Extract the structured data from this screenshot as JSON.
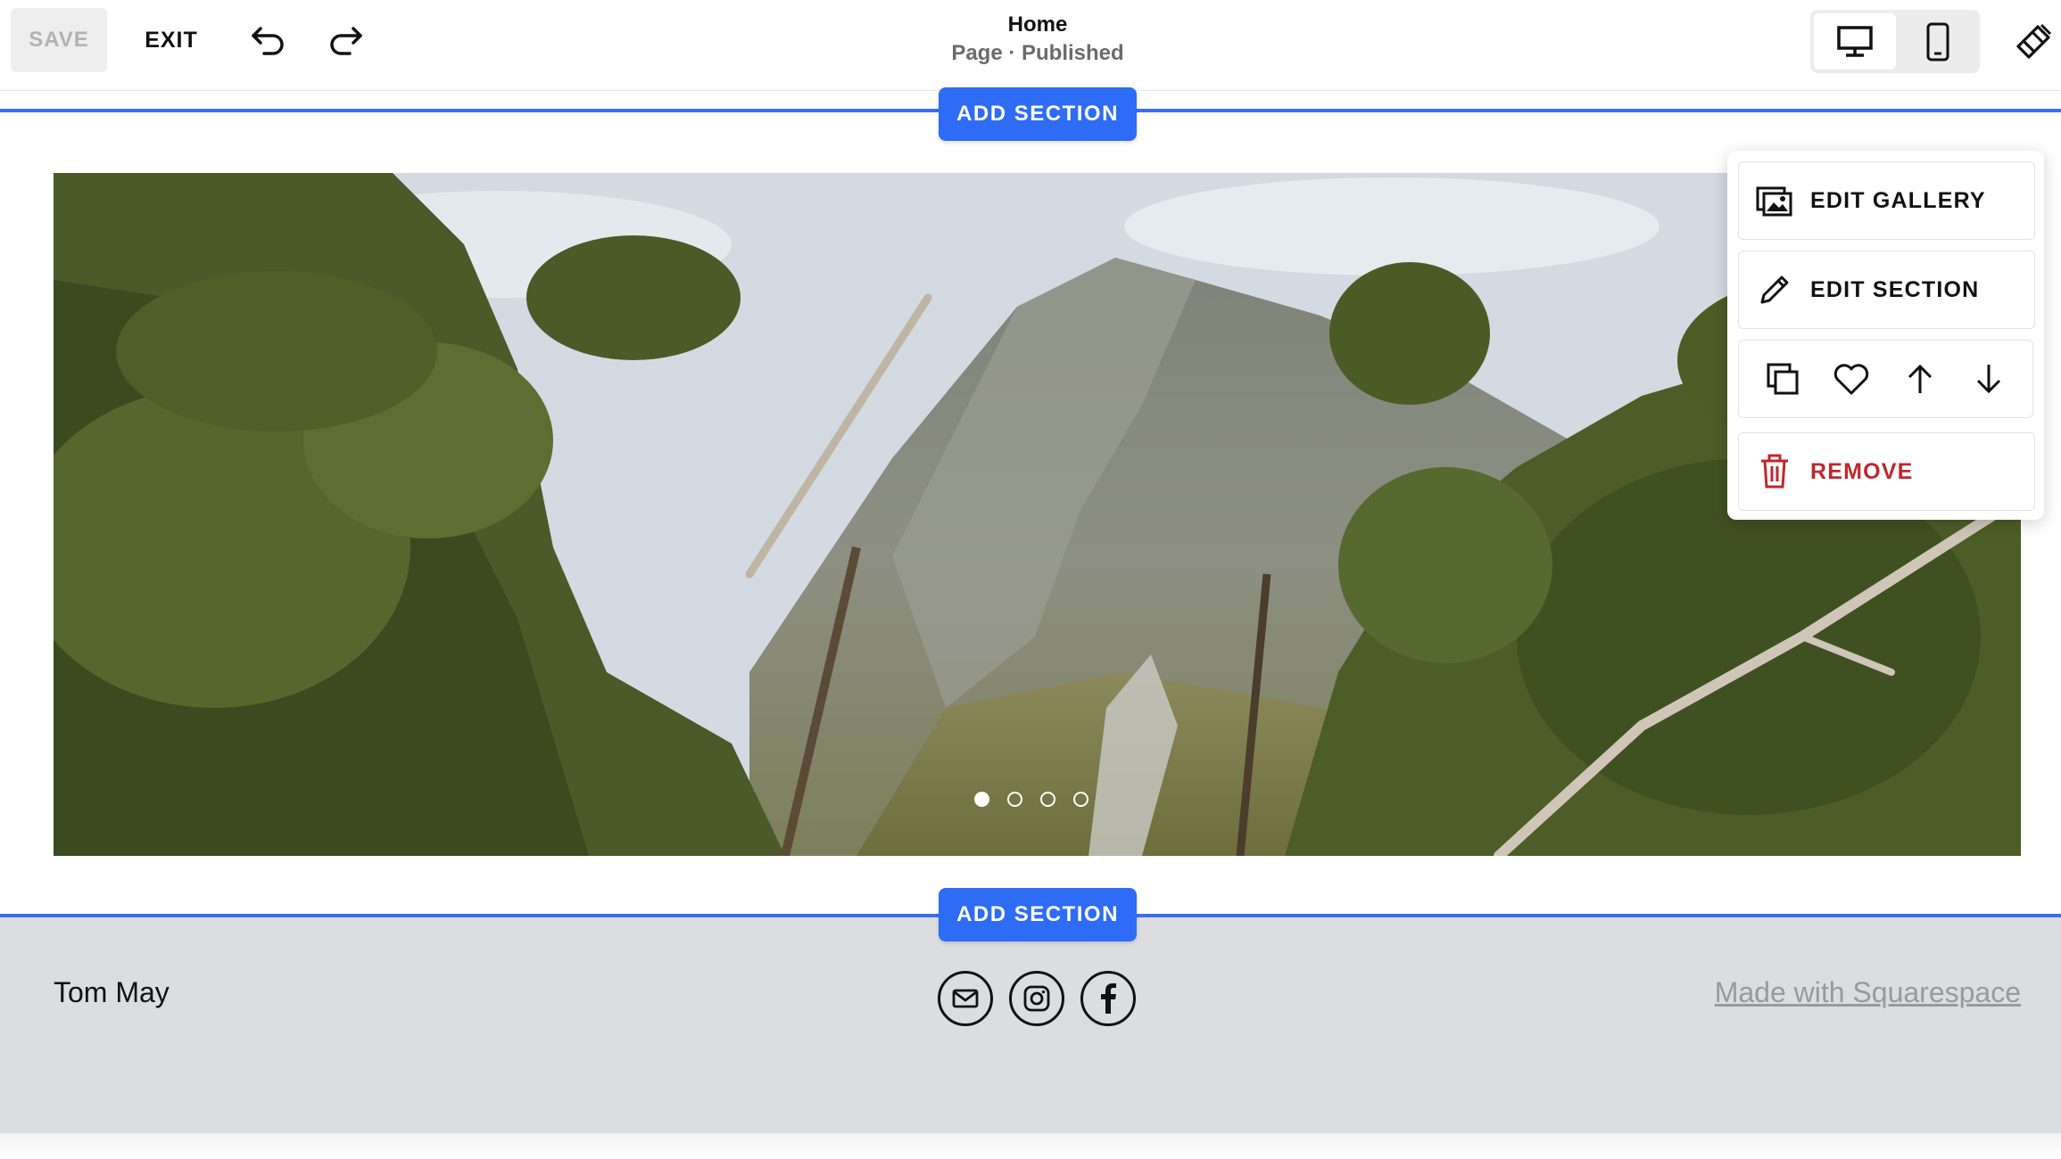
{
  "toolbar": {
    "save_label": "SAVE",
    "exit_label": "EXIT",
    "undo_icon": "undo-icon",
    "redo_icon": "redo-icon",
    "page_title": "Home",
    "page_status": "Page · Published",
    "device_modes": [
      "desktop",
      "mobile"
    ],
    "active_device": "desktop",
    "design_icon": "paintbrush-icon"
  },
  "sections": {
    "add_section_label": "ADD SECTION"
  },
  "gallery": {
    "slide_count": 4,
    "active_slide": 1
  },
  "context_menu": {
    "edit_gallery": "EDIT GALLERY",
    "edit_section": "EDIT SECTION",
    "actions": [
      "duplicate-icon",
      "heart-icon",
      "arrow-up-icon",
      "arrow-down-icon"
    ],
    "remove": "REMOVE",
    "remove_color": "#c0272d"
  },
  "footer": {
    "name": "Tom May",
    "social_icons": [
      "email-icon",
      "instagram-icon",
      "facebook-icon"
    ],
    "made_with": "Made with Squarespace"
  },
  "colors": {
    "accent": "#2e6cf5",
    "footer_bg": "#dcdde0"
  }
}
